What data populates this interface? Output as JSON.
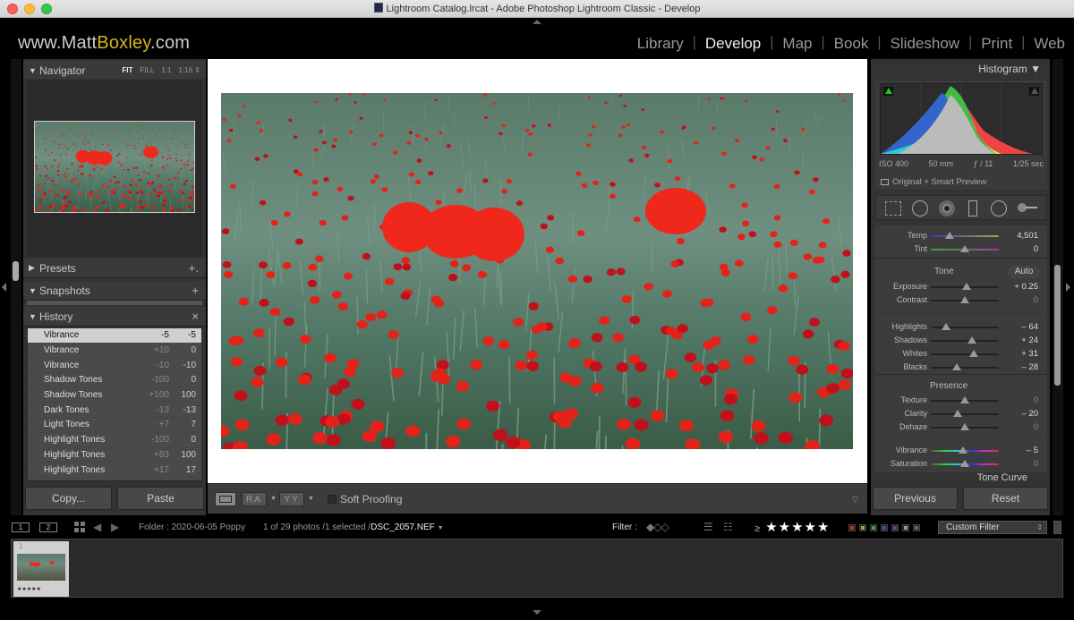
{
  "window": {
    "title": "Lightroom Catalog.lrcat - Adobe Photoshop Lightroom Classic - Develop"
  },
  "identity_plate": {
    "prefix": "www.Matt",
    "accent": "Boxley",
    "suffix": ".com",
    "accent_color": "#d6b51c"
  },
  "modules": [
    {
      "label": "Library",
      "active": false
    },
    {
      "label": "Develop",
      "active": true
    },
    {
      "label": "Map",
      "active": false
    },
    {
      "label": "Book",
      "active": false
    },
    {
      "label": "Slideshow",
      "active": false
    },
    {
      "label": "Print",
      "active": false
    },
    {
      "label": "Web",
      "active": false
    }
  ],
  "left_panel": {
    "navigator": {
      "title": "Navigator",
      "zoom_options": [
        "FIT",
        "FILL",
        "1:1",
        "1:16"
      ],
      "selected_zoom": "FIT"
    },
    "presets": {
      "title": "Presets",
      "action": "+."
    },
    "snapshots": {
      "title": "Snapshots",
      "action": "+"
    },
    "history": {
      "title": "History",
      "action": "×",
      "items": [
        {
          "name": "Vibrance",
          "delta": "-5",
          "value": "-5",
          "selected": true
        },
        {
          "name": "Vibrance",
          "delta": "+10",
          "value": "0"
        },
        {
          "name": "Vibrance",
          "delta": "-10",
          "value": "-10"
        },
        {
          "name": "Shadow Tones",
          "delta": "-100",
          "value": "0"
        },
        {
          "name": "Shadow Tones",
          "delta": "+100",
          "value": "100"
        },
        {
          "name": "Dark Tones",
          "delta": "-13",
          "value": "-13"
        },
        {
          "name": "Light Tones",
          "delta": "+7",
          "value": "7"
        },
        {
          "name": "Highlight Tones",
          "delta": "-100",
          "value": "0"
        },
        {
          "name": "Highlight Tones",
          "delta": "+83",
          "value": "100"
        },
        {
          "name": "Highlight Tones",
          "delta": "+17",
          "value": "17"
        }
      ]
    },
    "copy_label": "Copy...",
    "paste_label": "Paste"
  },
  "toolbar": {
    "ra_label": "RA",
    "yy_label": "YY",
    "soft_proofing_label": "Soft Proofing",
    "soft_proofing_checked": false
  },
  "right_panel": {
    "histogram": {
      "title": "Histogram",
      "iso": "ISO 400",
      "focal": "50 mm",
      "aperture": "ƒ / 11",
      "shutter": "1/25 sec",
      "preview_status": "Original + Smart Preview"
    },
    "tools": [
      "crop-overlay",
      "spot-removal",
      "red-eye",
      "graduated-filter",
      "radial-filter",
      "adjustment-brush"
    ],
    "wb": [
      {
        "label": "Temp",
        "value": "4,501",
        "position": 0.28
      },
      {
        "label": "Tint",
        "value": "0",
        "position": 0.5
      }
    ],
    "tone": {
      "title": "Tone",
      "auto_label": "Auto",
      "sliders": [
        {
          "label": "Exposure",
          "value": "+ 0.25",
          "position": 0.53
        },
        {
          "label": "Contrast",
          "value": "0",
          "position": 0.5,
          "dim": true
        }
      ],
      "tone_sliders": [
        {
          "label": "Highlights",
          "value": "– 64",
          "position": 0.23
        },
        {
          "label": "Shadows",
          "value": "+ 24",
          "position": 0.6
        },
        {
          "label": "Whites",
          "value": "+ 31",
          "position": 0.63
        },
        {
          "label": "Blacks",
          "value": "– 28",
          "position": 0.38
        }
      ]
    },
    "presence": {
      "title": "Presence",
      "sliders": [
        {
          "label": "Texture",
          "value": "0",
          "position": 0.5,
          "dim": true
        },
        {
          "label": "Clarity",
          "value": "– 20",
          "position": 0.4
        },
        {
          "label": "Dehaze",
          "value": "0",
          "position": 0.5,
          "dim": true
        }
      ],
      "color_sliders": [
        {
          "label": "Vibrance",
          "value": "– 5",
          "position": 0.47
        },
        {
          "label": "Saturation",
          "value": "0",
          "position": 0.5,
          "dim": true
        }
      ]
    },
    "next_panel": "Tone Curve",
    "previous_label": "Previous",
    "reset_label": "Reset"
  },
  "filmstrip_bar": {
    "screen1": "1",
    "screen2": "2",
    "folder": "Folder : 2020-06-05 Poppy",
    "count": "1 of 29 photos /1 selected /",
    "filename": "DSC_2057.NEF",
    "filter_label": "Filter :",
    "rating_operator": "≥",
    "rating_stars": "★★★★★",
    "color_labels": [
      "#b33",
      "#aa3",
      "#3a3",
      "#35b",
      "#73b",
      "#999",
      "#666"
    ],
    "custom_filter": "Custom Filter"
  },
  "filmstrip": {
    "items": [
      {
        "index": "1",
        "stars": "★★★★★",
        "selected": true
      }
    ]
  }
}
